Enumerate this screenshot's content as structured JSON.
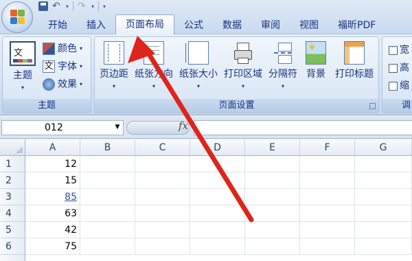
{
  "tabs": [
    "开始",
    "插入",
    "页面布局",
    "公式",
    "数据",
    "审阅",
    "视图",
    "福昕PDF"
  ],
  "active_tab": "页面布局",
  "ribbon": {
    "theme_group": {
      "label": "主题",
      "big_button": "主题",
      "colors": "颜色",
      "fonts": "字体",
      "effects": "效果",
      "theme_icon_text": "文"
    },
    "page_setup_group": {
      "label": "页面设置",
      "margins": "页边距",
      "orientation": "纸张方向",
      "size": "纸张大小",
      "print_area": "打印区域",
      "breaks": "分隔符",
      "background": "背景",
      "print_titles": "打印标题"
    },
    "scale_group": {
      "width": "宽",
      "height": "高",
      "scale": "缩",
      "label": "调"
    }
  },
  "formula_bar": {
    "name_box": "012",
    "fx_label": "fx",
    "formula": ""
  },
  "grid": {
    "columns": [
      "A",
      "B",
      "C",
      "D",
      "E",
      "F",
      "G"
    ],
    "rows": [
      {
        "n": "1",
        "a": "12"
      },
      {
        "n": "2",
        "a": "15"
      },
      {
        "n": "3",
        "a": "85"
      },
      {
        "n": "4",
        "a": "63"
      },
      {
        "n": "5",
        "a": "42"
      },
      {
        "n": "6",
        "a": "75"
      }
    ]
  },
  "colors": {
    "tab_text": "#15317e",
    "annotation_arrow": "#e0241b"
  }
}
